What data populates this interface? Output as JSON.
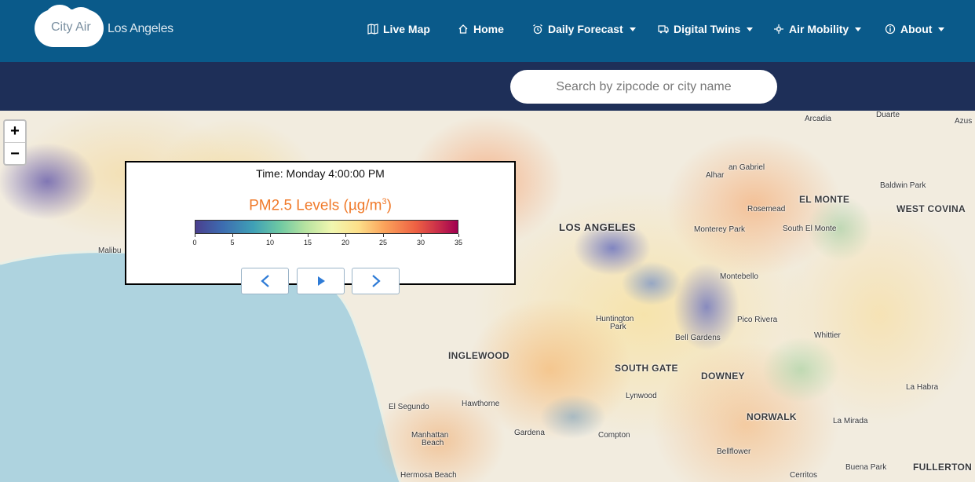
{
  "app": {
    "logo_name": "City Air",
    "city": "Los Angeles"
  },
  "nav": [
    {
      "label": "Live Map",
      "icon": "map-icon",
      "dropdown": false
    },
    {
      "label": "Home",
      "icon": "home-icon",
      "dropdown": false
    },
    {
      "label": "Daily Forecast",
      "icon": "alarm-clock-icon",
      "dropdown": true
    },
    {
      "label": "Digital Twins",
      "icon": "truck-icon",
      "dropdown": true
    },
    {
      "label": "Air Mobility",
      "icon": "drone-icon",
      "dropdown": true
    },
    {
      "label": "About",
      "icon": "info-icon",
      "dropdown": true
    }
  ],
  "search": {
    "placeholder": "Search by zipcode or city name",
    "value": ""
  },
  "map": {
    "zoom_in": "+",
    "zoom_out": "−",
    "places": [
      {
        "name": "Arcadia",
        "style": "small"
      },
      {
        "name": "Duarte",
        "style": "small"
      },
      {
        "name": "Azus",
        "style": "small"
      },
      {
        "name": "an Gabriel",
        "style": "small"
      },
      {
        "name": "Alhar",
        "style": "small"
      },
      {
        "name": "Baldwin Park",
        "style": "small"
      },
      {
        "name": "EL MONTE",
        "style": "big"
      },
      {
        "name": "Rosemead",
        "style": "small"
      },
      {
        "name": "WEST COVINA",
        "style": "big"
      },
      {
        "name": "LOS ANGELES",
        "style": "huge"
      },
      {
        "name": "Monterey Park",
        "style": "small"
      },
      {
        "name": "South El Monte",
        "style": "small"
      },
      {
        "name": "Malibu",
        "style": "small"
      },
      {
        "name": "Montebello",
        "style": "small"
      },
      {
        "name": "Huntington",
        "style": "small"
      },
      {
        "name": "Park",
        "style": "small"
      },
      {
        "name": "Pico Rivera",
        "style": "small"
      },
      {
        "name": "Whittier",
        "style": "small"
      },
      {
        "name": "Bell Gardens",
        "style": "small"
      },
      {
        "name": "INGLEWOOD",
        "style": "big"
      },
      {
        "name": "SOUTH GATE",
        "style": "big"
      },
      {
        "name": "DOWNEY",
        "style": "big"
      },
      {
        "name": "La Habra",
        "style": "small"
      },
      {
        "name": "Lynwood",
        "style": "small"
      },
      {
        "name": "Hawthorne",
        "style": "small"
      },
      {
        "name": "El Segundo",
        "style": "small"
      },
      {
        "name": "NORWALK",
        "style": "big"
      },
      {
        "name": "La Mirada",
        "style": "small"
      },
      {
        "name": "Gardena",
        "style": "small"
      },
      {
        "name": "Manhattan",
        "style": "small"
      },
      {
        "name": "Beach",
        "style": "small"
      },
      {
        "name": "Compton",
        "style": "small"
      },
      {
        "name": "Bellflower",
        "style": "small"
      },
      {
        "name": "Hermosa Beach",
        "style": "small"
      },
      {
        "name": "Cerritos",
        "style": "small"
      },
      {
        "name": "Buena Park",
        "style": "small"
      },
      {
        "name": "FULLERTON",
        "style": "big"
      }
    ]
  },
  "legend": {
    "time": "Time: Monday 4:00:00 PM",
    "title_main": "PM2.5 Levels (µg/m",
    "title_sup": "3",
    "title_close": ")",
    "ticks": [
      "0",
      "5",
      "10",
      "15",
      "20",
      "25",
      "30",
      "35"
    ],
    "scale_min": 0,
    "scale_max": 35,
    "colors": [
      "#4a3f8e",
      "#3fa0b6",
      "#b7e3a0",
      "#f1f7b0",
      "#fba35b",
      "#ee6143",
      "#a00050"
    ]
  },
  "controls": {
    "prev": "previous-icon",
    "play": "play-icon",
    "next": "next-icon"
  }
}
